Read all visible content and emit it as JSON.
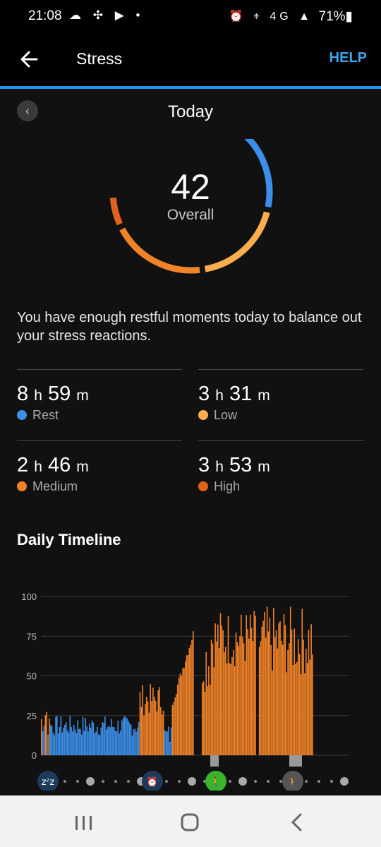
{
  "status_bar": {
    "time": "21:08",
    "left_icons": "☁ ✣ ▶ •",
    "right_icons": "⏰ ⌖ 4G ▲",
    "battery": "71%▮"
  },
  "app_bar": {
    "title": "Stress",
    "help_label": "HELP",
    "back_icon": "arrow-left-icon"
  },
  "day_nav": {
    "prev_label": "‹",
    "date_label": "Today"
  },
  "gauge": {
    "score": "42",
    "score_label": "Overall",
    "segments": [
      {
        "level": "Rest",
        "color": "#3b8fe8",
        "fraction": 0.4
      },
      {
        "level": "Low",
        "color": "#fbad4f",
        "fraction": 0.215
      },
      {
        "level": "Medium",
        "color": "#f08228",
        "fraction": 0.225
      },
      {
        "level": "High",
        "color": "#e2621c",
        "fraction": 0.075
      }
    ]
  },
  "message": "You have enough restful moments today to balance out your stress reactions.",
  "stats": [
    {
      "hours": "8",
      "h": "h",
      "minutes": "59",
      "m": "m",
      "label": "Rest",
      "color": "#3b8fe8"
    },
    {
      "hours": "3",
      "h": "h",
      "minutes": "31",
      "m": "m",
      "label": "Low",
      "color": "#fbad4f"
    },
    {
      "hours": "2",
      "h": "h",
      "minutes": "46",
      "m": "m",
      "label": "Medium",
      "color": "#f08228"
    },
    {
      "hours": "3",
      "h": "h",
      "minutes": "53",
      "m": "m",
      "label": "High",
      "color": "#e2621c"
    }
  ],
  "timeline": {
    "title": "Daily Timeline",
    "marker_icons": [
      "sleep-icon",
      "alarm-clock-icon",
      "walking-icon",
      "walking-icon"
    ]
  },
  "chart_data": {
    "type": "bar",
    "ylim": [
      0,
      100
    ],
    "yticks": [
      "100",
      "75",
      "50",
      "25",
      "0"
    ],
    "grid": true,
    "x_description": "time of day (continuous)",
    "series": [
      {
        "name": "",
        "color": "#3b8fe8",
        "segment": "Rest",
        "x_range": [
          0,
          0.35
        ],
        "y_range": [
          10,
          25
        ]
      },
      {
        "name": "",
        "color": "#f08228",
        "segment": "Stress",
        "x_range": [
          0.35,
          0.98
        ],
        "y_peaks": [
          45,
          78,
          92,
          94,
          90
        ]
      }
    ]
  },
  "nav": {
    "recents_icon": "recents-icon",
    "home_icon": "home-icon",
    "back_icon": "back-chevron-icon"
  }
}
